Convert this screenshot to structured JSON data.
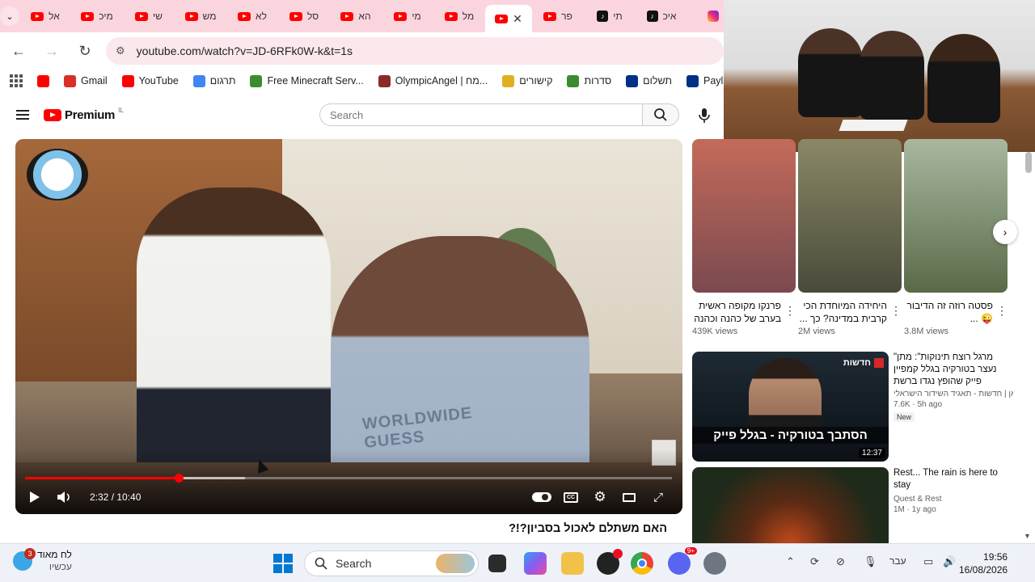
{
  "browser": {
    "tabs": [
      {
        "label": "אל",
        "icon": "youtube-icon"
      },
      {
        "label": "מיכ",
        "icon": "youtube-icon"
      },
      {
        "label": "שי",
        "icon": "youtube-icon"
      },
      {
        "label": "מש",
        "icon": "youtube-icon"
      },
      {
        "label": "לא",
        "icon": "youtube-icon"
      },
      {
        "label": "סל",
        "icon": "youtube-icon"
      },
      {
        "label": "הא",
        "icon": "youtube-icon"
      },
      {
        "label": "מי",
        "icon": "youtube-icon"
      },
      {
        "label": "מל",
        "icon": "youtube-icon"
      },
      {
        "label": "",
        "icon": "youtube-icon",
        "active": true
      },
      {
        "label": "פר",
        "icon": "youtube-icon"
      },
      {
        "label": "תי",
        "icon": "tiktok-icon"
      },
      {
        "label": "איכ",
        "icon": "tiktok-icon"
      },
      {
        "label": "",
        "icon": "instagram-icon"
      }
    ],
    "url": "youtube.com/watch?v=JD-6RFk0W-k&t=1s",
    "bookmarks": [
      {
        "label": "",
        "icon": "youtube-icon",
        "color": "#ff0000"
      },
      {
        "label": "Gmail",
        "icon": "gmail-icon",
        "color": "#d93025"
      },
      {
        "label": "YouTube",
        "icon": "youtube-icon",
        "color": "#ff0000"
      },
      {
        "label": "תרגום",
        "icon": "translate-icon",
        "color": "#4285f4"
      },
      {
        "label": "Free Minecraft Serv...",
        "icon": "minecraft-icon",
        "color": "#3a8c2e"
      },
      {
        "label": "OlympicAngel | מח...",
        "icon": "olympic-icon",
        "color": "#8a2a2a"
      },
      {
        "label": "קישורים",
        "icon": "star-icon",
        "color": "#e0b020"
      },
      {
        "label": "סדרות",
        "icon": "folder-icon",
        "color": "#3a8c2e"
      },
      {
        "label": "תשלום",
        "icon": "paypal-icon",
        "color": "#003087"
      },
      {
        "label": "Payl",
        "icon": "paypal-icon",
        "color": "#003087"
      }
    ]
  },
  "youtube": {
    "logo_text": "Premium",
    "country": "IL",
    "search_placeholder": "Search"
  },
  "player": {
    "time": "2:32 / 10:40",
    "progress_fraction": 0.2375,
    "buffered_fraction": 0.34,
    "title": "האם משתלם לאכול בסביון?!?"
  },
  "shorts": [
    {
      "title": "פרנקו מקופה ראשית בערב של כהנה וכהנה",
      "views": "439K views",
      "color": "#b3565a"
    },
    {
      "title": "היחידה המיוחדת הכי קרבית במדינה? כך ...",
      "views": "2M views",
      "color": "#6b6a4a"
    },
    {
      "title": "פסטה רוזה זה הדיבור 😜 ...",
      "views": "3.8M views",
      "color": "#8a9a7a"
    }
  ],
  "recommended": [
    {
      "title": "\"מרגל רוצח תינוקות\": מתן נעצר בטורקיה בגלל קמפיין פייק שהופץ נגדו ברשת",
      "channel": "כאן | חדשות - תאגיד השידור הישראלי",
      "stats": "7.6K · 5h ago",
      "badge": "New",
      "duration": "12:37",
      "overlay": "הסתבך בטורקיה - בגלל פייק",
      "overlay_tag": "חדשות"
    },
    {
      "title": "Rest... The rain is here to stay",
      "channel": "Quest & Rest",
      "stats": "1M · 1y ago",
      "badge": "",
      "duration": "",
      "overlay": "",
      "overlay_tag": ""
    }
  ],
  "taskbar": {
    "weather_text": "לח מאוד",
    "weather_sub": "עכשיו",
    "notif_count": "3",
    "search_label": "Search",
    "language": "עבר",
    "time": "19:56",
    "date": "16/08/2026",
    "discord_badge": "9+"
  }
}
